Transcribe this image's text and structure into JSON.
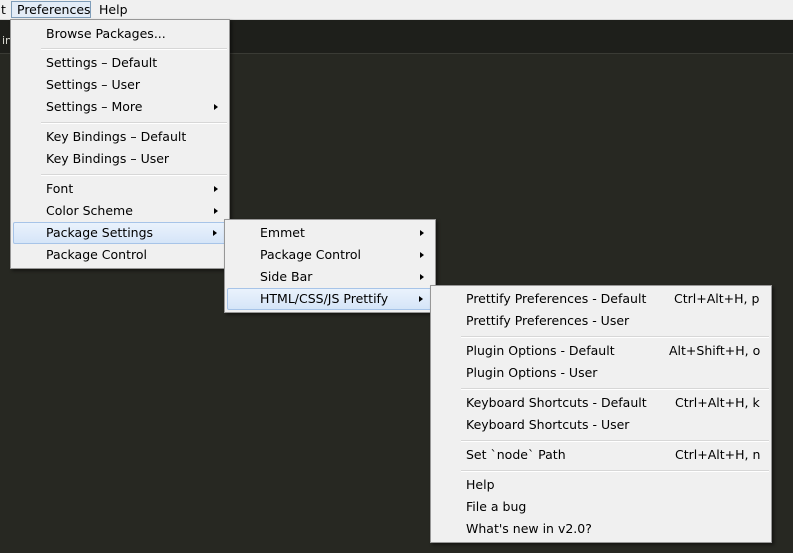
{
  "menubar": {
    "items": [
      {
        "label": "t"
      },
      {
        "label": "Preferences"
      },
      {
        "label": "Help"
      }
    ]
  },
  "editor": {
    "tab_text": "in"
  },
  "preferences_menu": {
    "items": [
      {
        "label": "Browse Packages..."
      },
      {
        "label": "Settings – Default"
      },
      {
        "label": "Settings – User"
      },
      {
        "label": "Settings – More"
      },
      {
        "label": "Key Bindings – Default"
      },
      {
        "label": "Key Bindings – User"
      },
      {
        "label": "Font"
      },
      {
        "label": "Color Scheme"
      },
      {
        "label": "Package Settings"
      },
      {
        "label": "Package Control"
      }
    ]
  },
  "package_settings_menu": {
    "items": [
      {
        "label": "Emmet"
      },
      {
        "label": "Package Control"
      },
      {
        "label": "Side Bar"
      },
      {
        "label": "HTML/CSS/JS Prettify"
      }
    ]
  },
  "prettify_menu": {
    "items": [
      {
        "label": "Prettify Preferences - Default",
        "shortcut": "Ctrl+Alt+H, p"
      },
      {
        "label": "Prettify Preferences - User",
        "shortcut": ""
      },
      {
        "label": "Plugin Options - Default",
        "shortcut": "Alt+Shift+H, o"
      },
      {
        "label": "Plugin Options - User",
        "shortcut": ""
      },
      {
        "label": "Keyboard Shortcuts - Default",
        "shortcut": "Ctrl+Alt+H, k"
      },
      {
        "label": "Keyboard Shortcuts - User",
        "shortcut": ""
      },
      {
        "label": "Set `node` Path",
        "shortcut": "Ctrl+Alt+H, n"
      },
      {
        "label": "Help",
        "shortcut": ""
      },
      {
        "label": "File a bug",
        "shortcut": ""
      },
      {
        "label": "What's new in v2.0?",
        "shortcut": ""
      }
    ]
  }
}
